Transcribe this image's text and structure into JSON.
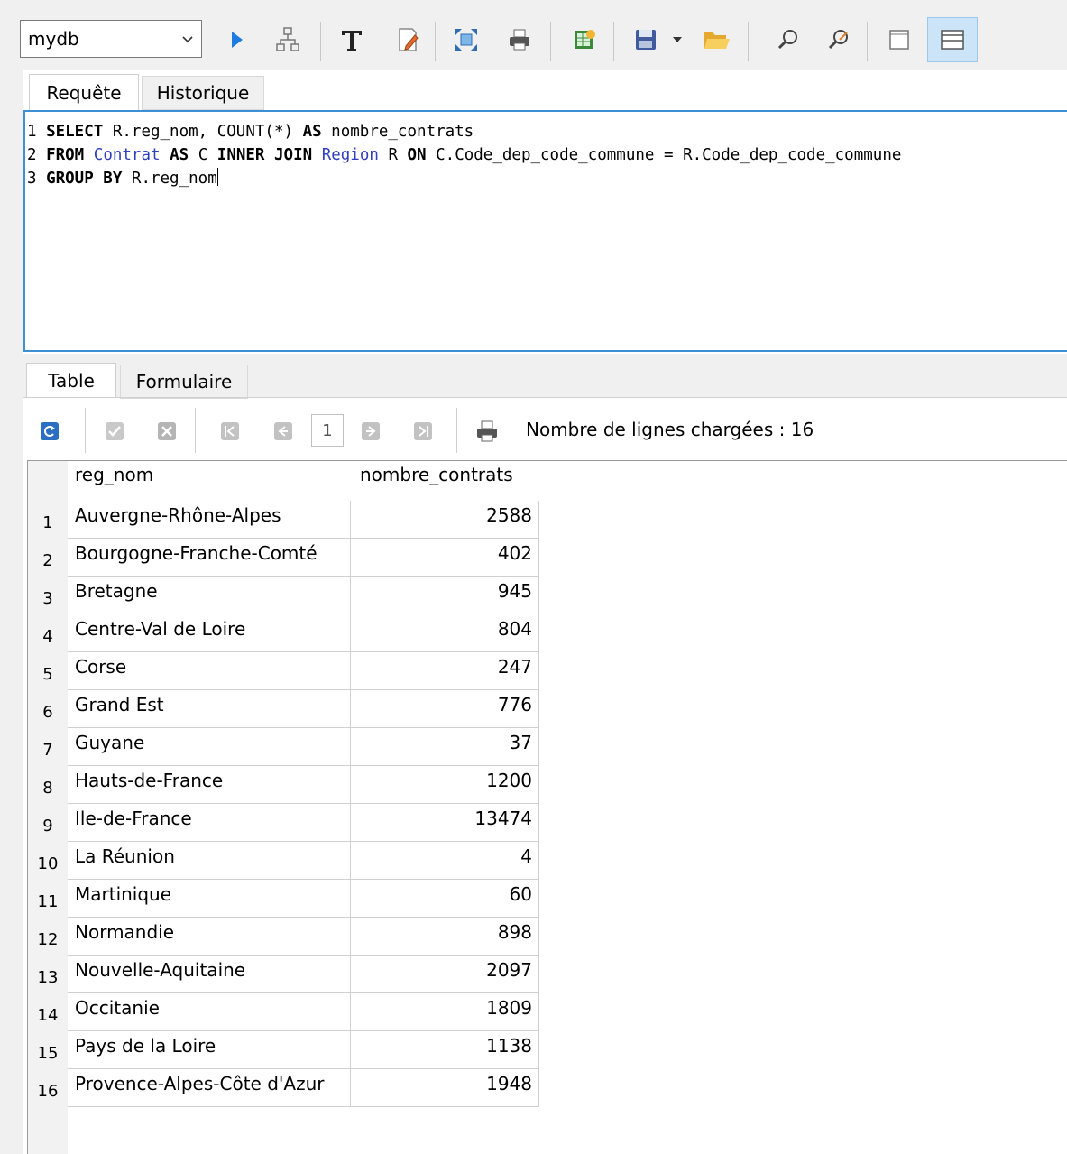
{
  "database": {
    "selected": "mydb"
  },
  "query_tabs": {
    "request": "Requête",
    "history": "Historique"
  },
  "editor": {
    "lines": [
      [
        {
          "t": "1 ",
          "c": ""
        },
        {
          "t": "SELECT",
          "c": "kw"
        },
        {
          "t": " R.reg_nom, COUNT(*) ",
          "c": ""
        },
        {
          "t": "AS",
          "c": "kw"
        },
        {
          "t": " nombre_contrats",
          "c": ""
        }
      ],
      [
        {
          "t": "2 ",
          "c": ""
        },
        {
          "t": "FROM",
          "c": "kw"
        },
        {
          "t": " ",
          "c": ""
        },
        {
          "t": "Contrat",
          "c": "tbl"
        },
        {
          "t": " ",
          "c": ""
        },
        {
          "t": "AS",
          "c": "kw"
        },
        {
          "t": " C ",
          "c": ""
        },
        {
          "t": "INNER JOIN",
          "c": "kw"
        },
        {
          "t": " ",
          "c": ""
        },
        {
          "t": "Region",
          "c": "tbl"
        },
        {
          "t": " R ",
          "c": ""
        },
        {
          "t": "ON",
          "c": "kw"
        },
        {
          "t": " C.Code_dep_code_commune = R.Code_dep_code_commune",
          "c": ""
        }
      ],
      [
        {
          "t": "3 ",
          "c": ""
        },
        {
          "t": "GROUP BY",
          "c": "kw"
        },
        {
          "t": " R.reg_nom",
          "c": ""
        }
      ]
    ]
  },
  "result_tabs": {
    "table": "Table",
    "form": "Formulaire"
  },
  "pagination": {
    "page": "1"
  },
  "rows_loaded": "Nombre de lignes chargées : 16",
  "grid": {
    "columns": [
      "reg_nom",
      "nombre_contrats"
    ],
    "rows": [
      {
        "n": "1",
        "name": "Auvergne-Rhône-Alpes",
        "count": "2588"
      },
      {
        "n": "2",
        "name": "Bourgogne-Franche-Comté",
        "count": "402"
      },
      {
        "n": "3",
        "name": "Bretagne",
        "count": "945"
      },
      {
        "n": "4",
        "name": "Centre-Val de Loire",
        "count": "804"
      },
      {
        "n": "5",
        "name": "Corse",
        "count": "247"
      },
      {
        "n": "6",
        "name": "Grand Est",
        "count": "776"
      },
      {
        "n": "7",
        "name": "Guyane",
        "count": "37"
      },
      {
        "n": "8",
        "name": "Hauts-de-France",
        "count": "1200"
      },
      {
        "n": "9",
        "name": "Ile-de-France",
        "count": "13474"
      },
      {
        "n": "10",
        "name": "La Réunion",
        "count": "4"
      },
      {
        "n": "11",
        "name": "Martinique",
        "count": "60"
      },
      {
        "n": "12",
        "name": "Normandie",
        "count": "898"
      },
      {
        "n": "13",
        "name": "Nouvelle-Aquitaine",
        "count": "2097"
      },
      {
        "n": "14",
        "name": "Occitanie",
        "count": "1809"
      },
      {
        "n": "15",
        "name": "Pays de la Loire",
        "count": "1138"
      },
      {
        "n": "16",
        "name": "Provence-Alpes-Côte d'Azur",
        "count": "1948"
      }
    ]
  },
  "colors": {
    "accent": "#3d8fd6",
    "table_name": "#2f3fbd",
    "run": "#1e7be0"
  }
}
